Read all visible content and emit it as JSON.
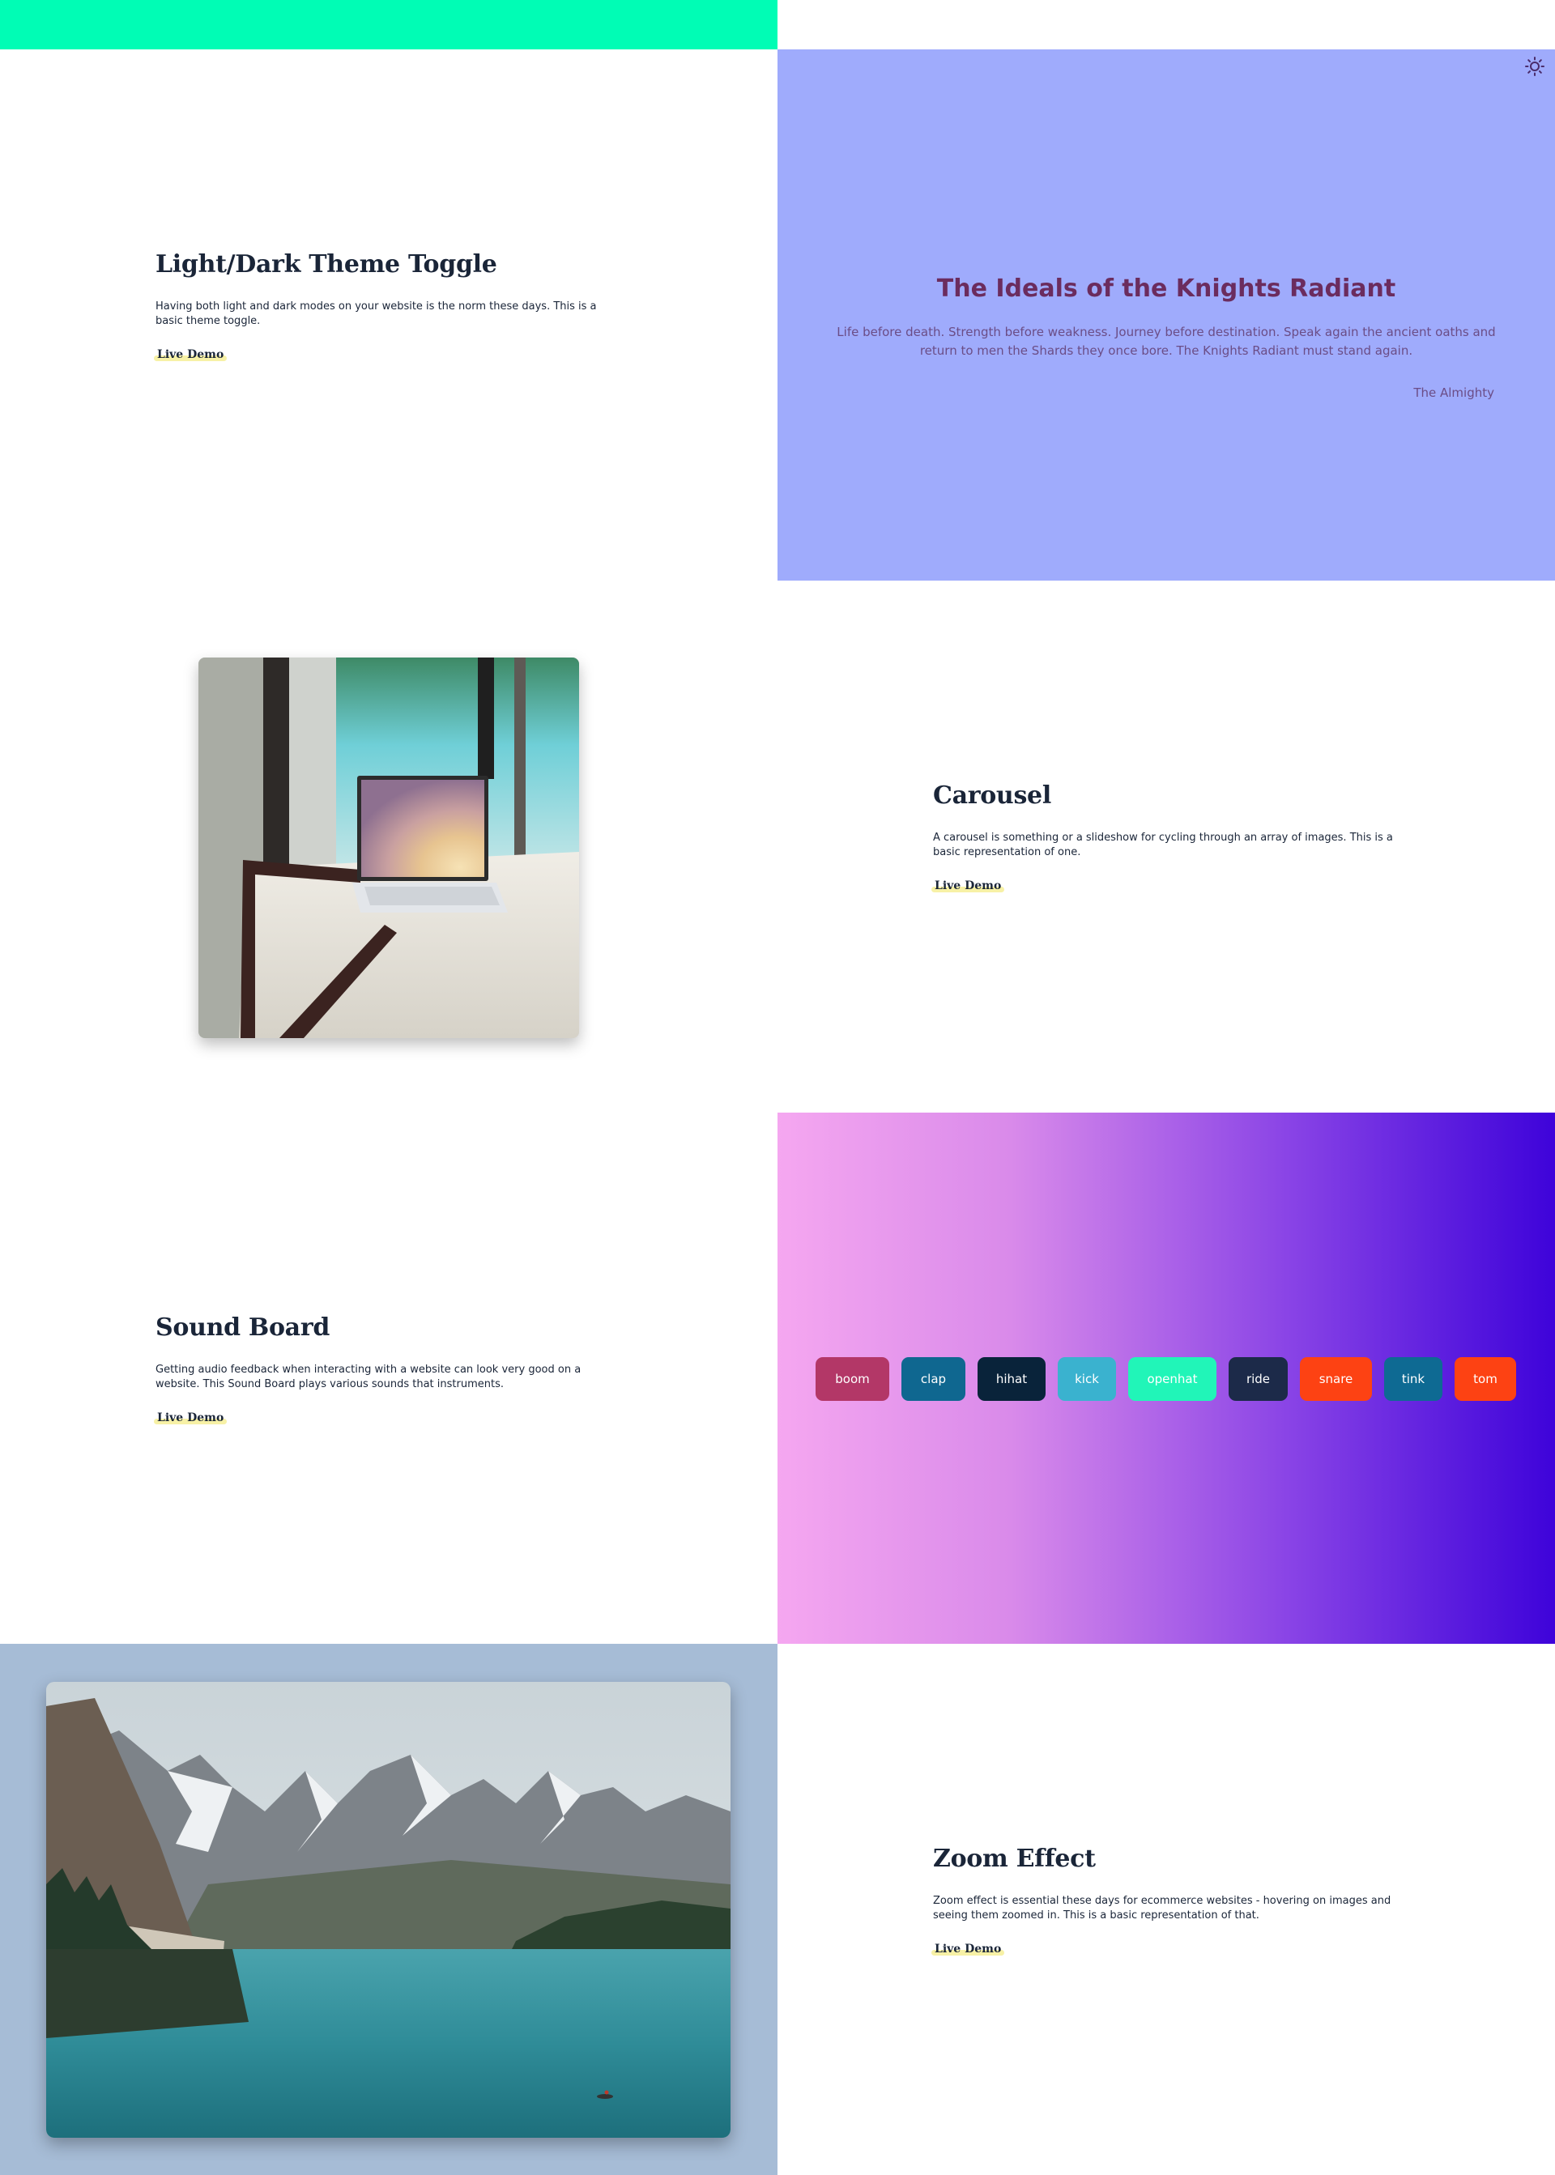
{
  "colors": {
    "top_accent": "#00fdb5",
    "theme_preview_bg": "#9fabfc",
    "sound_gradient": [
      "#f5a7f0",
      "#3e03da"
    ],
    "zoom_bg": "#a6bcd6",
    "link_highlight": "#f7f1a6"
  },
  "theme_toggle": {
    "title": "Light/Dark Theme Toggle",
    "description": "Having both light and dark modes on your website is the norm these days. This is a basic theme toggle.",
    "link": "Live Demo",
    "preview": {
      "toggle_icon": "sun-icon",
      "quote_title": "The Ideals of the Knights Radiant",
      "quote_text": "Life before death. Strength before weakness. Journey before destination. Speak again the ancient oaths and return to men the Shards they once bore. The Knights Radiant must stand again.",
      "quote_author": "The Almighty"
    }
  },
  "carousel": {
    "title": "Carousel",
    "description": "A carousel is something or a slideshow for cycling through an array of images. This is a basic representation of one.",
    "link": "Live Demo"
  },
  "sound_board": {
    "title": "Sound Board",
    "description": "Getting audio feedback when interacting with a website can look very good on a website. This Sound Board plays various sounds that instruments.",
    "link": "Live Demo",
    "buttons": [
      {
        "label": "boom",
        "color": "#b33767"
      },
      {
        "label": "clap",
        "color": "#0f6790"
      },
      {
        "label": "hihat",
        "color": "#09233a"
      },
      {
        "label": "kick",
        "color": "#3ab2cf"
      },
      {
        "label": "openhat",
        "color": "#21f5b8"
      },
      {
        "label": "ride",
        "color": "#1c2a49"
      },
      {
        "label": "snare",
        "color": "#fd4213"
      },
      {
        "label": "tink",
        "color": "#0e6a93"
      },
      {
        "label": "tom",
        "color": "#fd4213"
      }
    ]
  },
  "zoom_effect": {
    "title": "Zoom Effect",
    "description": "Zoom effect is essential these days for ecommerce websites - hovering on images and seeing them zoomed in. This is a basic representation of that.",
    "link": "Live Demo"
  }
}
